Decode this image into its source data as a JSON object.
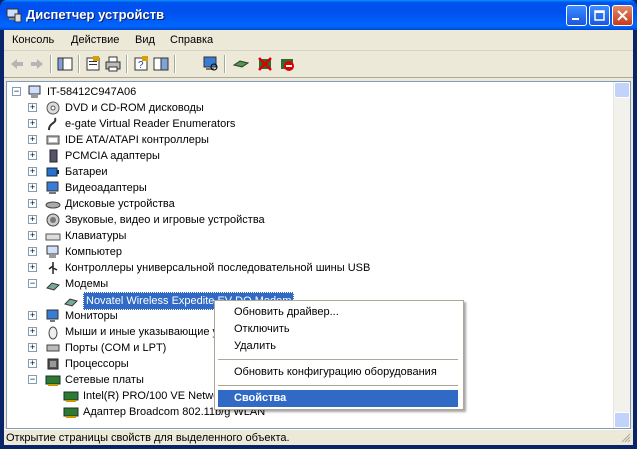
{
  "window": {
    "title": "Диспетчер устройств"
  },
  "menu": [
    "Консоль",
    "Действие",
    "Вид",
    "Справка"
  ],
  "tree": {
    "root": "IT-58412C947A06",
    "items": [
      {
        "label": "DVD и CD-ROM дисководы",
        "icon": "cdrom-icon"
      },
      {
        "label": "e-gate Virtual Reader Enumerators",
        "icon": "reader-icon"
      },
      {
        "label": "IDE ATA/ATAPI контроллеры",
        "icon": "ide-controller-icon"
      },
      {
        "label": "PCMCIA адаптеры",
        "icon": "pcmcia-icon"
      },
      {
        "label": "Батареи",
        "icon": "battery-icon"
      },
      {
        "label": "Видеоадаптеры",
        "icon": "display-adapter-icon"
      },
      {
        "label": "Дисковые устройства",
        "icon": "disk-drive-icon"
      },
      {
        "label": "Звуковые, видео и игровые устройства",
        "icon": "sound-icon"
      },
      {
        "label": "Клавиатуры",
        "icon": "keyboard-icon"
      },
      {
        "label": "Компьютер",
        "icon": "computer-icon"
      },
      {
        "label": "Контроллеры универсальной последовательной шины USB",
        "icon": "usb-icon"
      },
      {
        "label": "Модемы",
        "icon": "modem-icon"
      },
      {
        "label": "Novatel Wireless Expedite EV-DO Modem",
        "icon": "modem-icon"
      },
      {
        "label": "Мониторы",
        "icon": "monitor-icon"
      },
      {
        "label": "Мыши и иные указывающие у",
        "icon": "mouse-icon"
      },
      {
        "label": "Порты (COM и LPT)",
        "icon": "port-icon"
      },
      {
        "label": "Процессоры",
        "icon": "processor-icon"
      },
      {
        "label": "Сетевые платы",
        "icon": "network-card-icon"
      },
      {
        "label": "Intel(R) PRO/100 VE Netwo",
        "icon": "network-card-icon"
      },
      {
        "label": "Адаптер Broadcom 802.11b/g WLAN",
        "icon": "network-card-icon"
      }
    ]
  },
  "context_menu": {
    "update_driver": "Обновить драйвер...",
    "disable": "Отключить",
    "remove": "Удалить",
    "scan_changes": "Обновить конфигурацию оборудования",
    "properties": "Свойства"
  },
  "status": "Открытие страницы свойств для выделенного объекта.",
  "colors": {
    "selection": "#316ac5",
    "titlebar": "#0053ee",
    "face": "#ece9d8"
  }
}
